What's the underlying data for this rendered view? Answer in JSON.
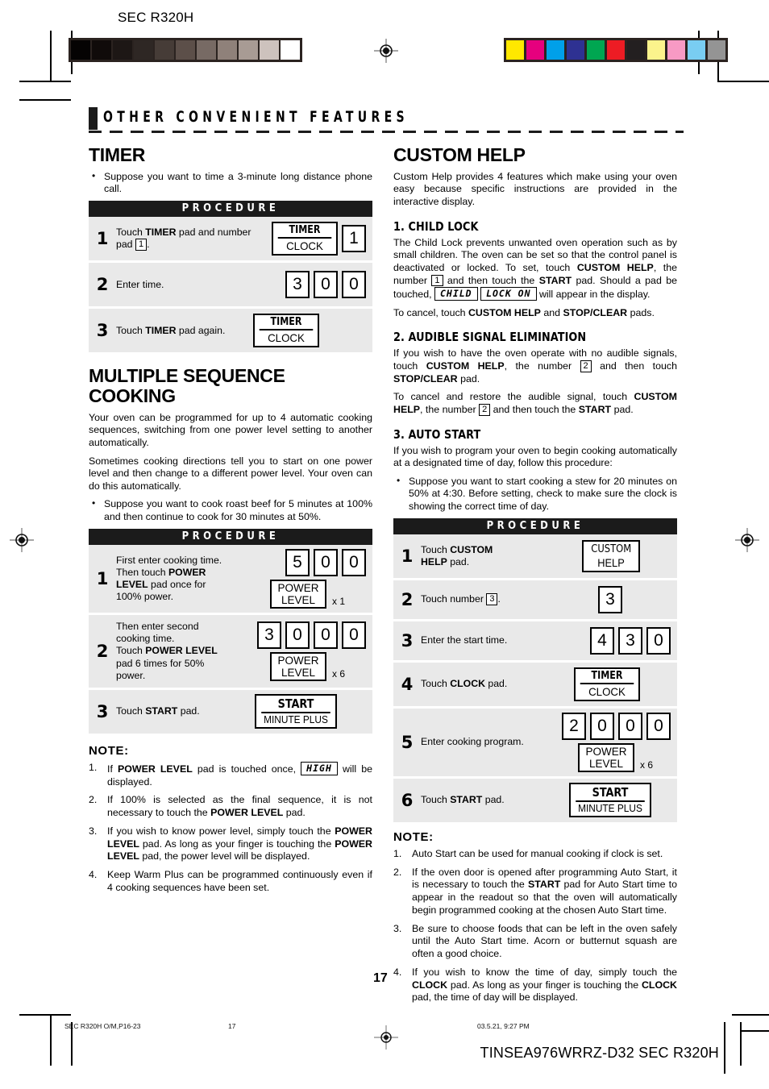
{
  "header": {
    "doc_title": "SEC R320H",
    "grey_wedge": [
      "#050303",
      "#100b0a",
      "#1d1715",
      "#2e2724",
      "#463c37",
      "#5c4f49",
      "#776a64",
      "#8f817a",
      "#a89b94",
      "#cdc2bd",
      "#ffffff"
    ],
    "colour_wedge": [
      "#ffe800",
      "#e6007e",
      "#00a0e9",
      "#2e3192",
      "#00a651",
      "#ed1c24",
      "#231f20",
      "#fbf38c",
      "#f79ac4",
      "#79cdf2",
      "#949494"
    ]
  },
  "section": {
    "banner_title": "OTHER CONVENIENT FEATURES"
  },
  "left": {
    "timer": {
      "heading": "TIMER",
      "bullet": "Suppose you want to time a 3-minute long distance phone call.",
      "procedure_label": "PROCEDURE",
      "steps": [
        {
          "num": "1",
          "text_1": "Touch ",
          "bold_1": "TIMER",
          "text_2": " pad and number pad ",
          "key_inline": "1",
          "text_3": "."
        },
        {
          "num": "2",
          "text_1": "Enter time."
        },
        {
          "num": "3",
          "text_1": "Touch ",
          "bold_1": "TIMER",
          "text_2": " pad again."
        }
      ],
      "pads": {
        "timer_top": "TIMER",
        "timer_bottom": "CLOCK",
        "num_1": "1",
        "time_digits": [
          "3",
          "0",
          "0"
        ]
      }
    },
    "msc": {
      "heading_line1": "MULTIPLE SEQUENCE",
      "heading_line2": "COOKING",
      "para_1": "Your oven can be programmed for up to 4 automatic cooking sequences, switching from one power level setting to another automatically.",
      "para_2": "Sometimes cooking directions tell you to start on one power level and then change to a different power level. Your oven can do this automatically.",
      "bullet": "Suppose you want to cook roast beef for 5 minutes at 100% and then continue to cook for 30 minutes at 50%.",
      "procedure_label": "PROCEDURE",
      "steps": [
        {
          "num": "1",
          "l1a": "First enter cooking time.",
          "l2a": "Then touch ",
          "l2b": "POWER",
          "l3a": "LEVEL",
          "l3b": " pad once for",
          "l4a": "100% power.",
          "digits": [
            "5",
            "0",
            "0"
          ],
          "pad_top": "POWER",
          "pad_bottom": "LEVEL",
          "mult": "x 1"
        },
        {
          "num": "2",
          "l1a": "Then enter second",
          "l2a": "cooking time.",
          "l3a": "Touch ",
          "l3b": "POWER LEVEL",
          "l4a": "pad 6 times for 50%",
          "l5a": "power.",
          "digits": [
            "3",
            "0",
            "0",
            "0"
          ],
          "pad_top": "POWER",
          "pad_bottom": "LEVEL",
          "mult": "x 6"
        },
        {
          "num": "3",
          "text_1": "Touch ",
          "bold_1": "START",
          "text_2": " pad.",
          "start_top": "START",
          "start_bottom": "MINUTE PLUS"
        }
      ]
    },
    "note": {
      "heading": "NOTE:",
      "items": [
        {
          "a": "If ",
          "b": "POWER LEVEL",
          "c": " pad is touched once, ",
          "disp": "HIGH",
          "d": " will be displayed."
        },
        {
          "a": "If 100% is selected as the final sequence, it is not necessary to touch the ",
          "b": "POWER LEVEL",
          "c": " pad."
        },
        {
          "a": "If you wish to know power level, simply touch the ",
          "b": "POWER LEVEL",
          "c": " pad. As long as your finger is touching the ",
          "b2": "POWER LEVEL",
          "d": " pad, the power level will be displayed."
        },
        {
          "a": "Keep Warm Plus can be programmed continuously even if 4 cooking sequences have been set."
        }
      ]
    }
  },
  "right": {
    "custom_help": {
      "heading": "CUSTOM HELP",
      "intro": "Custom Help provides 4 features which make using your oven easy because specific instructions are provided in the interactive display."
    },
    "child_lock": {
      "heading": "1. CHILD LOCK",
      "p1a": "The Child Lock prevents unwanted oven operation such as by small children. The oven can be set so that the control panel is deactivated or locked. To set, touch ",
      "p1b": "CUSTOM HELP",
      "p1c": ", the number ",
      "key1": "1",
      "p1d": " and then touch the ",
      "p1e": "START",
      "p1f": " pad. Should a pad be touched, ",
      "disp1": "CHILD",
      "disp2": "LOCK ON",
      "p1g": " will appear in the display.",
      "p2a": "To cancel, touch ",
      "p2b": "CUSTOM HELP",
      "p2c": " and ",
      "p2d": "STOP/CLEAR",
      "p2e": " pads."
    },
    "audible": {
      "heading": "2. AUDIBLE SIGNAL ELIMINATION",
      "p1a": "If you wish to have the oven operate with no audible signals, touch ",
      "p1b": "CUSTOM HELP",
      "p1c": ", the number ",
      "key2": "2",
      "p1d": " and then touch ",
      "p1e": "STOP/CLEAR",
      "p1f": " pad.",
      "p2a": "To cancel and restore the audible signal, touch ",
      "p2b": "CUSTOM HELP",
      "p2c": ", the number ",
      "key2b": "2",
      "p2d": " and then touch the ",
      "p2e": "START",
      "p2f": " pad."
    },
    "auto_start": {
      "heading": "3. AUTO START",
      "intro": "If you wish to program your oven to begin cooking automatically at a designated time of day, follow this procedure:",
      "bullet": "Suppose you want to start cooking a stew for 20 minutes on 50% at 4:30. Before setting, check to make sure the clock is showing the correct time of day.",
      "procedure_label": "PROCEDURE",
      "steps": [
        {
          "num": "1",
          "l1a": "Touch ",
          "l1b": "CUSTOM",
          "l2a": "HELP",
          "l2b": " pad.",
          "pad_top": "CUSTOM",
          "pad_bottom": "HELP"
        },
        {
          "num": "2",
          "text_1": "Touch number ",
          "key_inline": "3",
          "text_2": ".",
          "digit": "3"
        },
        {
          "num": "3",
          "text_1": "Enter the start time.",
          "digits": [
            "4",
            "3",
            "0"
          ]
        },
        {
          "num": "4",
          "text_1": "Touch ",
          "bold_1": "CLOCK",
          "text_2": " pad.",
          "pad_top": "TIMER",
          "pad_bottom": "CLOCK"
        },
        {
          "num": "5",
          "text_1": "Enter cooking program.",
          "digits": [
            "2",
            "0",
            "0",
            "0"
          ],
          "pad_top": "POWER",
          "pad_bottom": "LEVEL",
          "mult": "x 6"
        },
        {
          "num": "6",
          "text_1": "Touch ",
          "bold_1": "START",
          "text_2": " pad.",
          "start_top": "START",
          "start_bottom": "MINUTE PLUS"
        }
      ]
    },
    "note": {
      "heading": "NOTE:",
      "items": [
        {
          "a": "Auto Start can be used for manual cooking if clock is set."
        },
        {
          "a": "If the oven door is opened after programming Auto Start, it is necessary to touch the ",
          "b": "START",
          "c": " pad for Auto Start time to appear in the readout so that the oven will automatically begin programmed cooking at the chosen Auto Start time."
        },
        {
          "a": "Be sure to choose foods that can be left in the oven safely until the Auto Start time. Acorn or butternut squash are often a good choice."
        },
        {
          "a": "If you wish to know the time of day, simply touch the ",
          "b": "CLOCK",
          "c": " pad. As long as your finger is touching the ",
          "b2": "CLOCK",
          "d": " pad, the time of day will be displayed."
        }
      ]
    }
  },
  "footer": {
    "page_number": "17",
    "file_ref": "SEC R320H O/M,P16-23",
    "page_ref": "17",
    "timestamp": "03.5.21, 9:27 PM",
    "brand_code": "TINSEA976WRRZ-D32 SEC R320H"
  }
}
